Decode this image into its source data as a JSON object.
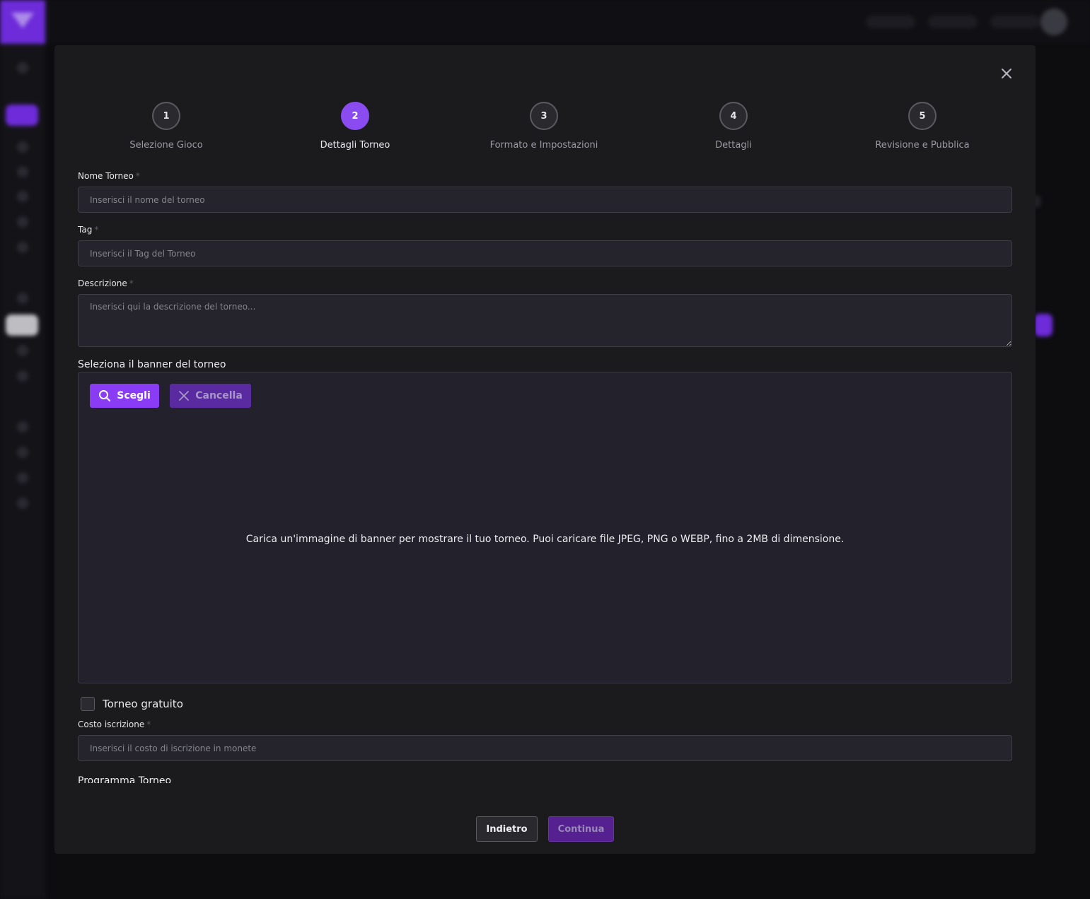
{
  "stepper": {
    "steps": [
      {
        "number": "1",
        "label": "Selezione Gioco"
      },
      {
        "number": "2",
        "label": "Dettagli Torneo"
      },
      {
        "number": "3",
        "label": "Formato e Impostazioni"
      },
      {
        "number": "4",
        "label": "Dettagli"
      },
      {
        "number": "5",
        "label": "Revisione e Pubblica"
      }
    ],
    "active_step": 2
  },
  "form": {
    "name": {
      "label": "Nome Torneo",
      "required_mark": "*",
      "placeholder": "Inserisci il nome del torneo",
      "value": ""
    },
    "tag": {
      "label": "Tag",
      "required_mark": "*",
      "placeholder": "Inserisci il Tag del Torneo",
      "value": ""
    },
    "description": {
      "label": "Descrizione",
      "required_mark": "*",
      "placeholder": "Inserisci qui la descrizione del torneo...",
      "value": ""
    },
    "banner": {
      "label": "Seleziona il banner del torneo",
      "choose_label": "Scegli",
      "cancel_label": "Cancella",
      "hint": "Carica un'immagine di banner per mostrare il tuo torneo. Puoi caricare file JPEG, PNG o WEBP, fino a 2MB di dimensione."
    },
    "free_tournament": {
      "label": "Torneo gratuito",
      "checked": false
    },
    "entry_cost": {
      "label": "Costo iscrizione",
      "required_mark": "*",
      "placeholder": "Inserisci il costo di iscrizione in monete",
      "value": ""
    },
    "schedule": {
      "label": "Programma Torneo"
    }
  },
  "footer": {
    "back_label": "Indietro",
    "continue_label": "Continua"
  },
  "colors": {
    "accent": "#8a3cf5",
    "accent_disabled": "#55208f",
    "modal_bg": "#1b1b1e",
    "input_bg": "#25232c"
  },
  "icons": {
    "close": "close-icon",
    "choose": "search-icon",
    "cancel": "x-icon"
  }
}
